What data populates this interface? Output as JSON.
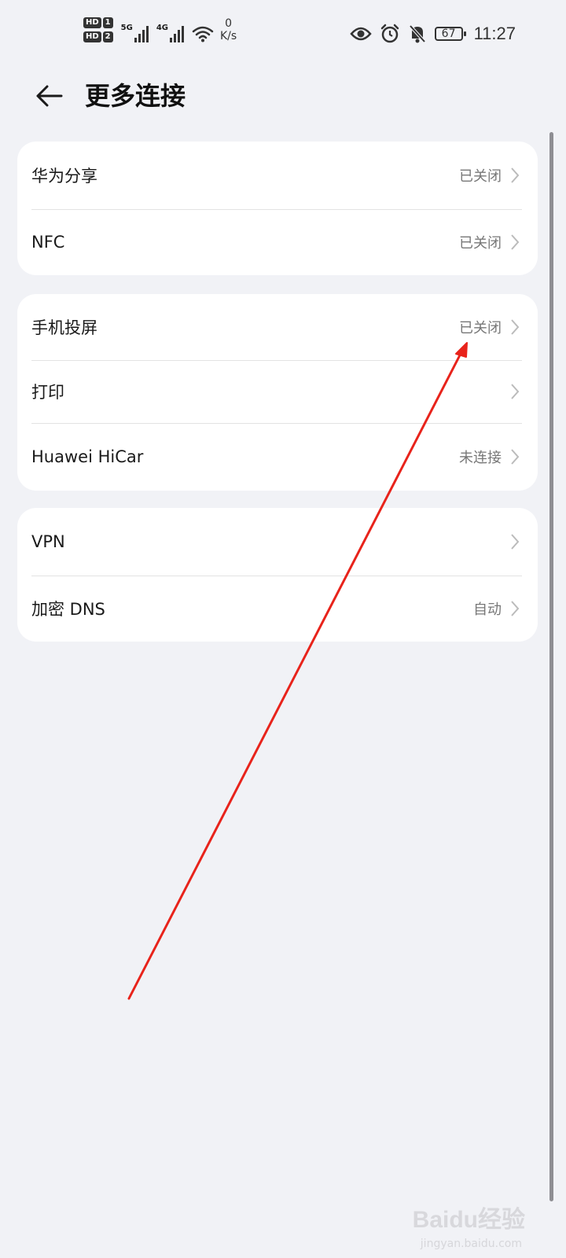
{
  "status_bar": {
    "hd1": "HD",
    "hd1_num": "1",
    "hd2": "HD",
    "hd2_num": "2",
    "net1": "5G",
    "net2": "4G",
    "speed_value": "0",
    "speed_unit": "K/s",
    "battery": "67",
    "time": "11:27"
  },
  "header": {
    "title": "更多连接"
  },
  "groups": [
    {
      "items": [
        {
          "label": "华为分享",
          "value": "已关闭"
        },
        {
          "label": "NFC",
          "value": "已关闭"
        }
      ]
    },
    {
      "items": [
        {
          "label": "手机投屏",
          "value": "已关闭"
        },
        {
          "label": "打印",
          "value": ""
        },
        {
          "label": "Huawei HiCar",
          "value": "未连接"
        }
      ]
    },
    {
      "items": [
        {
          "label": "VPN",
          "value": ""
        },
        {
          "label": "加密 DNS",
          "value": "自动"
        }
      ]
    }
  ],
  "watermark": {
    "brand": "Baidu经验",
    "url": "jingyan.baidu.com"
  },
  "colors": {
    "background": "#f1f2f6",
    "card": "#ffffff",
    "annotation_arrow": "#e8231b"
  }
}
